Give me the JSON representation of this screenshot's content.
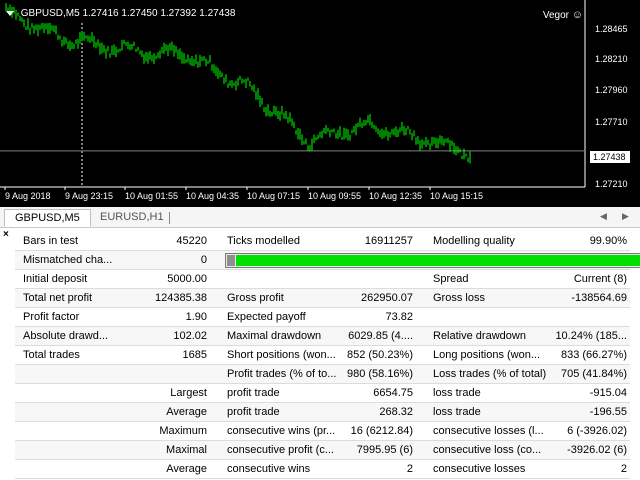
{
  "chart": {
    "symbol_header": "GBPUSD,M5",
    "ohlc": "1.27416 1.27450 1.27392 1.27438",
    "indicator": "Vegor",
    "indicator_icon": "smiley-icon",
    "price_ticks": [
      "1.28465",
      "1.28210",
      "1.27960",
      "1.27710",
      "1.27210"
    ],
    "current_price": "1.27438",
    "time_ticks": [
      "9 Aug 2018",
      "9 Aug 23:15",
      "10 Aug 01:55",
      "10 Aug 04:35",
      "10 Aug 07:15",
      "10 Aug 09:55",
      "10 Aug 12:35",
      "10 Aug 15:15"
    ],
    "colors": {
      "background": "#000000",
      "bars": "#00ff00",
      "text": "#ffffff"
    }
  },
  "chart_data": {
    "type": "line",
    "title": "GBPUSD,M5",
    "x": [
      "9 Aug 2018",
      "9 Aug 23:15",
      "10 Aug 01:55",
      "10 Aug 04:35",
      "10 Aug 07:15",
      "10 Aug 09:55",
      "10 Aug 12:35",
      "10 Aug 15:15"
    ],
    "values": [
      1.2855,
      1.2833,
      1.2825,
      1.282,
      1.2795,
      1.2752,
      1.2765,
      1.2743
    ],
    "ylim": [
      1.2715,
      1.286
    ],
    "current_price": 1.27438
  },
  "tabs": [
    {
      "label": "GBPUSD,M5",
      "active": true
    },
    {
      "label": "EURUSD,H1",
      "active": false
    }
  ],
  "report": {
    "row0": {
      "c1": "Bars in test",
      "c2": "45220",
      "c3": "Ticks modelled",
      "c4": "16911257",
      "c5": "Modelling quality",
      "c6": "99.90%"
    },
    "row1": {
      "c1": "Mismatched cha...",
      "c2": "0",
      "progress": 0.999
    },
    "row2": {
      "c1": "Initial deposit",
      "c2": "5000.00",
      "c5": "Spread",
      "c6": "Current (8)"
    },
    "row3": {
      "c1": "Total net profit",
      "c2": "124385.38",
      "c3": "Gross profit",
      "c4": "262950.07",
      "c5": "Gross loss",
      "c6": "-138564.69"
    },
    "row4": {
      "c1": "Profit factor",
      "c2": "1.90",
      "c3": "Expected payoff",
      "c4": "73.82"
    },
    "row5": {
      "c1": "Absolute drawd...",
      "c2": "102.02",
      "c3": "Maximal drawdown",
      "c4": "6029.85 (4....",
      "c5": "Relative drawdown",
      "c6": "10.24% (185..."
    },
    "row6": {
      "c1": "Total trades",
      "c2": "1685",
      "c3": "Short positions (won...",
      "c4": "852 (50.23%)",
      "c5": "Long positions (won...",
      "c6": "833 (66.27%)"
    },
    "row7": {
      "c3": "Profit trades (% of to...",
      "c4": "980 (58.16%)",
      "c5": "Loss trades (% of total)",
      "c6": "705 (41.84%)"
    },
    "row8": {
      "c2": "Largest",
      "c3": "profit trade",
      "c4": "6654.75",
      "c5": "loss trade",
      "c6": "-915.04"
    },
    "row9": {
      "c2": "Average",
      "c3": "profit trade",
      "c4": "268.32",
      "c5": "loss trade",
      "c6": "-196.55"
    },
    "row10": {
      "c2": "Maximum",
      "c3": "consecutive wins (pr...",
      "c4": "16 (6212.84)",
      "c5": "consecutive losses (l...",
      "c6": "6 (-3926.02)"
    },
    "row11": {
      "c2": "Maximal",
      "c3": "consecutive profit (c...",
      "c4": "7995.95 (6)",
      "c5": "consecutive loss (co...",
      "c6": "-3926.02 (6)"
    },
    "row12": {
      "c2": "Average",
      "c3": "consecutive wins",
      "c4": "2",
      "c5": "consecutive losses",
      "c6": "2"
    }
  }
}
